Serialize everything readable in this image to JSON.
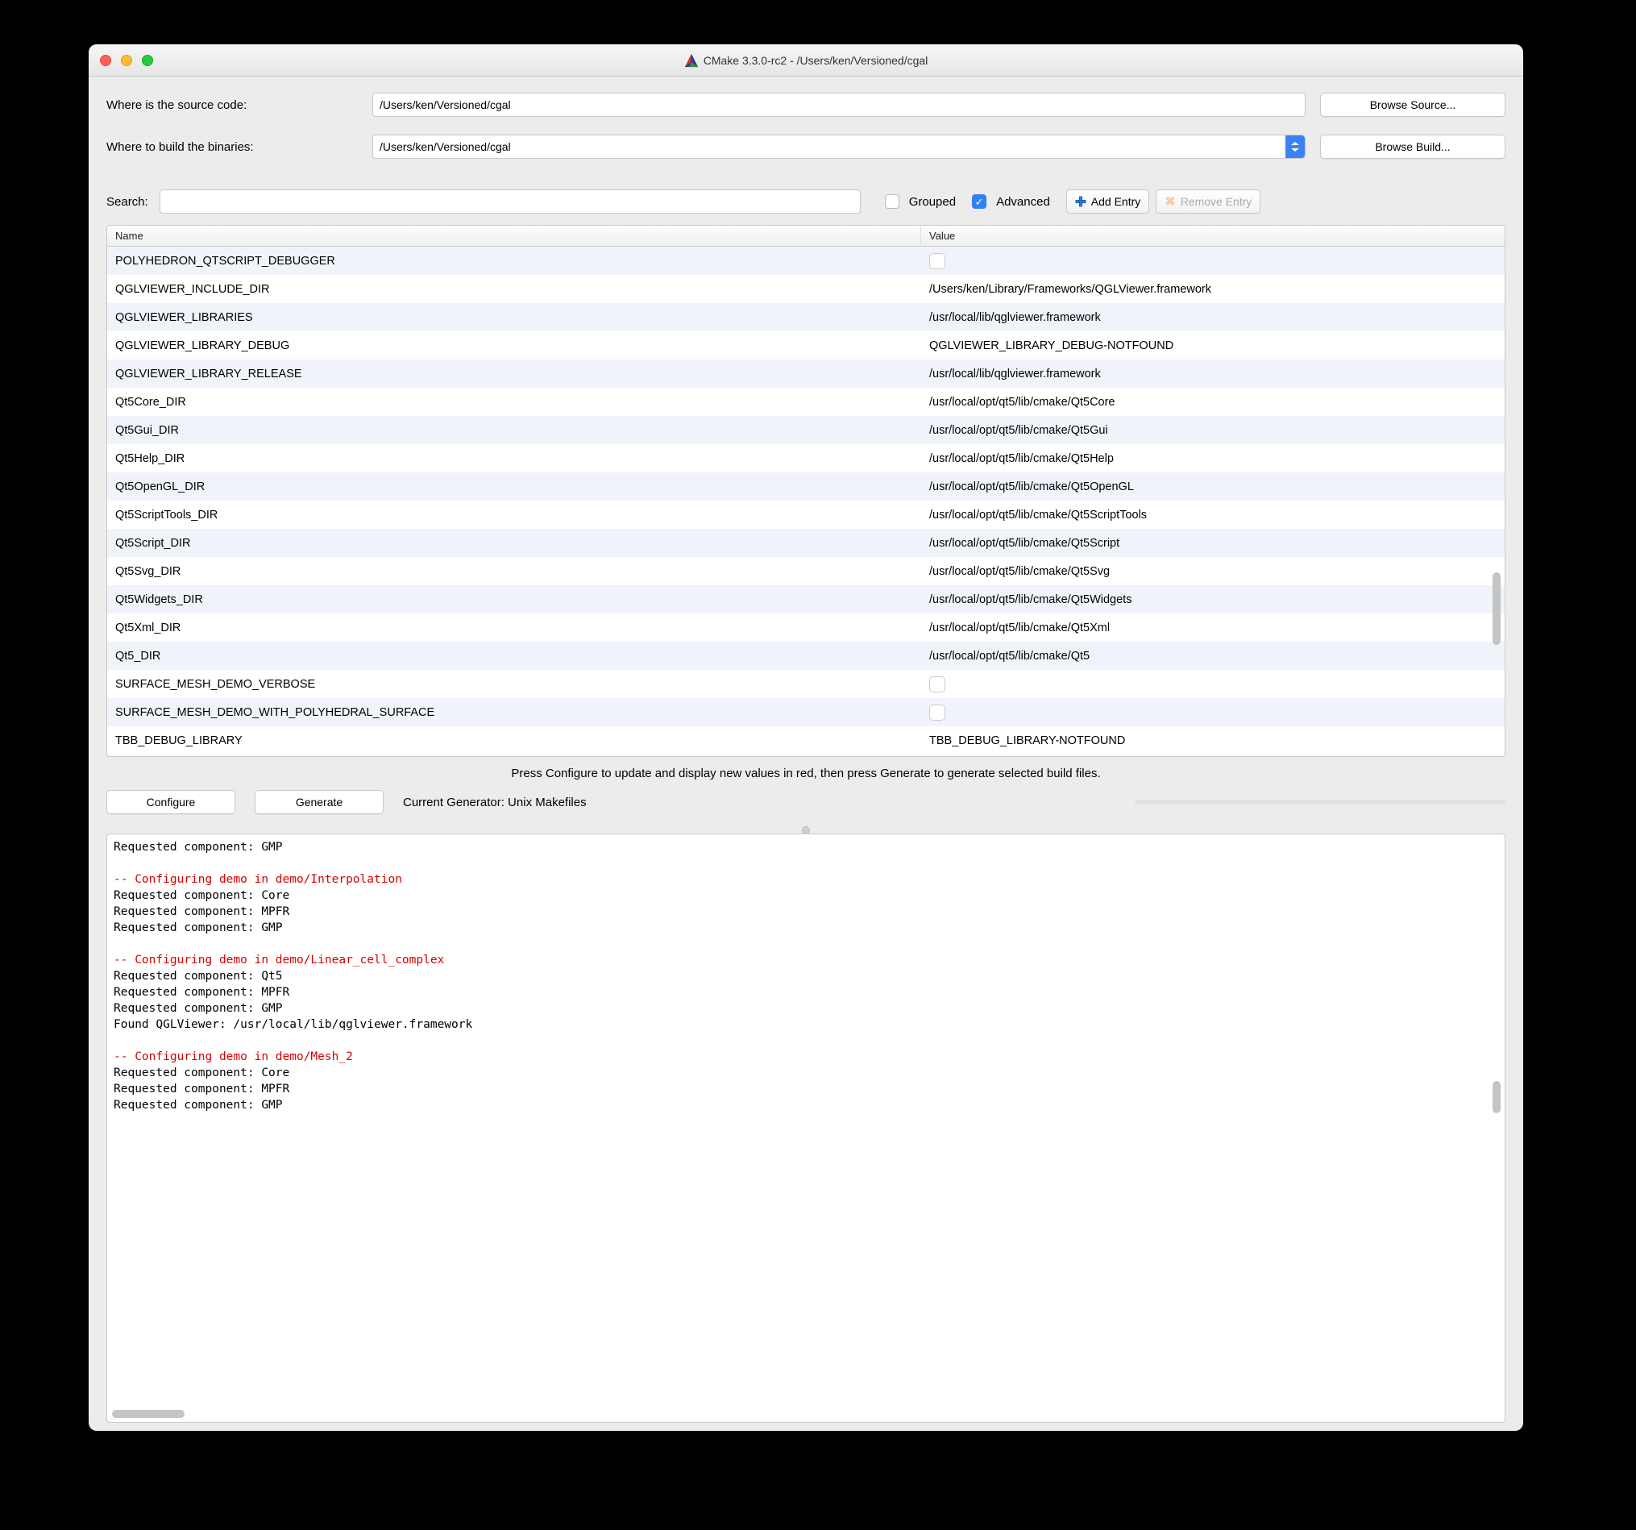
{
  "window": {
    "title": "CMake 3.3.0-rc2 - /Users/ken/Versioned/cgal"
  },
  "paths": {
    "source_label": "Where is the source code:",
    "source_value": "/Users/ken/Versioned/cgal",
    "browse_source": "Browse Source...",
    "build_label": "Where to build the binaries:",
    "build_value": "/Users/ken/Versioned/cgal",
    "browse_build": "Browse Build..."
  },
  "toolbar": {
    "search_label": "Search:",
    "search_value": "",
    "grouped_label": "Grouped",
    "grouped_checked": false,
    "advanced_label": "Advanced",
    "advanced_checked": true,
    "add_entry": "Add Entry",
    "remove_entry": "Remove Entry"
  },
  "table": {
    "headers": {
      "name": "Name",
      "value": "Value"
    },
    "rows": [
      {
        "name": "POLYHEDRON_QTSCRIPT_DEBUGGER",
        "value": "",
        "type": "bool"
      },
      {
        "name": "QGLVIEWER_INCLUDE_DIR",
        "value": "/Users/ken/Library/Frameworks/QGLViewer.framework",
        "type": "path"
      },
      {
        "name": "QGLVIEWER_LIBRARIES",
        "value": "/usr/local/lib/qglviewer.framework",
        "type": "path"
      },
      {
        "name": "QGLVIEWER_LIBRARY_DEBUG",
        "value": "QGLVIEWER_LIBRARY_DEBUG-NOTFOUND",
        "type": "path"
      },
      {
        "name": "QGLVIEWER_LIBRARY_RELEASE",
        "value": "/usr/local/lib/qglviewer.framework",
        "type": "path"
      },
      {
        "name": "Qt5Core_DIR",
        "value": "/usr/local/opt/qt5/lib/cmake/Qt5Core",
        "type": "path"
      },
      {
        "name": "Qt5Gui_DIR",
        "value": "/usr/local/opt/qt5/lib/cmake/Qt5Gui",
        "type": "path"
      },
      {
        "name": "Qt5Help_DIR",
        "value": "/usr/local/opt/qt5/lib/cmake/Qt5Help",
        "type": "path"
      },
      {
        "name": "Qt5OpenGL_DIR",
        "value": "/usr/local/opt/qt5/lib/cmake/Qt5OpenGL",
        "type": "path"
      },
      {
        "name": "Qt5ScriptTools_DIR",
        "value": "/usr/local/opt/qt5/lib/cmake/Qt5ScriptTools",
        "type": "path"
      },
      {
        "name": "Qt5Script_DIR",
        "value": "/usr/local/opt/qt5/lib/cmake/Qt5Script",
        "type": "path"
      },
      {
        "name": "Qt5Svg_DIR",
        "value": "/usr/local/opt/qt5/lib/cmake/Qt5Svg",
        "type": "path"
      },
      {
        "name": "Qt5Widgets_DIR",
        "value": "/usr/local/opt/qt5/lib/cmake/Qt5Widgets",
        "type": "path"
      },
      {
        "name": "Qt5Xml_DIR",
        "value": "/usr/local/opt/qt5/lib/cmake/Qt5Xml",
        "type": "path"
      },
      {
        "name": "Qt5_DIR",
        "value": "/usr/local/opt/qt5/lib/cmake/Qt5",
        "type": "path"
      },
      {
        "name": "SURFACE_MESH_DEMO_VERBOSE",
        "value": "",
        "type": "bool"
      },
      {
        "name": "SURFACE_MESH_DEMO_WITH_POLYHEDRAL_SURFACE",
        "value": "",
        "type": "bool"
      },
      {
        "name": "TBB_DEBUG_LIBRARY",
        "value": "TBB_DEBUG_LIBRARY-NOTFOUND",
        "type": "path"
      }
    ]
  },
  "hint": "Press Configure to update and display new values in red, then press Generate to generate selected build files.",
  "actions": {
    "configure": "Configure",
    "generate": "Generate",
    "generator_label": "Current Generator: Unix Makefiles"
  },
  "output_lines": [
    {
      "text": "Requested component: GMP",
      "red": false
    },
    {
      "text": "",
      "red": false
    },
    {
      "text": "-- Configuring demo in demo/Interpolation",
      "red": true
    },
    {
      "text": "Requested component: Core",
      "red": false
    },
    {
      "text": "Requested component: MPFR",
      "red": false
    },
    {
      "text": "Requested component: GMP",
      "red": false
    },
    {
      "text": "",
      "red": false
    },
    {
      "text": "-- Configuring demo in demo/Linear_cell_complex",
      "red": true
    },
    {
      "text": "Requested component: Qt5",
      "red": false
    },
    {
      "text": "Requested component: MPFR",
      "red": false
    },
    {
      "text": "Requested component: GMP",
      "red": false
    },
    {
      "text": "Found QGLViewer: /usr/local/lib/qglviewer.framework",
      "red": false
    },
    {
      "text": "",
      "red": false
    },
    {
      "text": "-- Configuring demo in demo/Mesh_2",
      "red": true
    },
    {
      "text": "Requested component: Core",
      "red": false
    },
    {
      "text": "Requested component: MPFR",
      "red": false
    },
    {
      "text": "Requested component: GMP",
      "red": false
    }
  ]
}
